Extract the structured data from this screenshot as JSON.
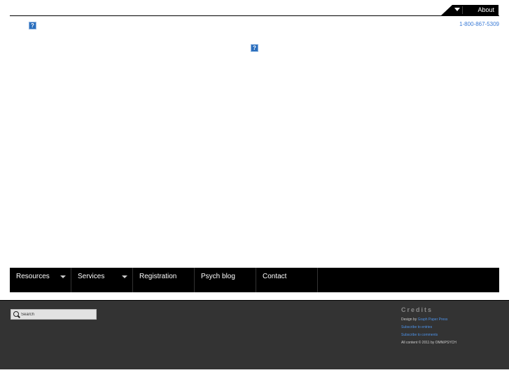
{
  "header": {
    "about_label": "About",
    "phone": "1-800-867-5309"
  },
  "broken_images": {
    "glyph": "?"
  },
  "nav": {
    "items": [
      {
        "label": "Resources",
        "has_dropdown": true
      },
      {
        "label": "Services",
        "has_dropdown": true
      },
      {
        "label": "Registration",
        "has_dropdown": false
      },
      {
        "label": "Psych blog",
        "has_dropdown": false
      },
      {
        "label": "Contact",
        "has_dropdown": false
      }
    ]
  },
  "footer": {
    "search": {
      "placeholder": "Search",
      "icon": "search-icon"
    },
    "credits": {
      "title": "Credits",
      "design_prefix": "Design by ",
      "design_link": "Graph Paper Press",
      "subscribe_entries": "Subscribe to entries",
      "subscribe_comments": "Subscribe to comments",
      "copyright": "All content © 2011 by OMNIPSYCH"
    }
  },
  "colors": {
    "nav_bg": "#000000",
    "footer_bg": "#333333",
    "link": "#4d92e8"
  }
}
